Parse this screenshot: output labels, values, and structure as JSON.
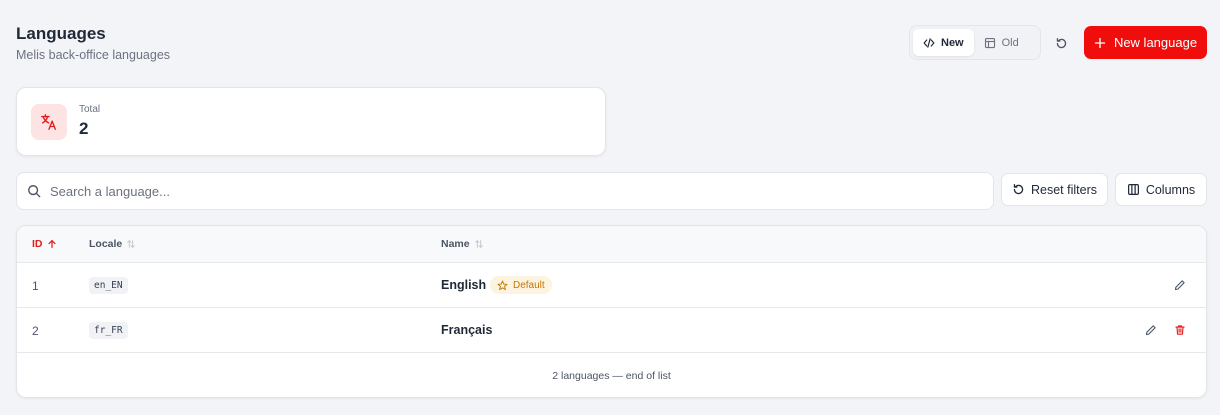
{
  "header": {
    "title": "Languages",
    "subtitle": "Melis back-office languages"
  },
  "view_toggle": {
    "options": [
      {
        "label": "New",
        "icon": "code-icon",
        "active": true
      },
      {
        "label": "Old",
        "icon": "layout-icon",
        "active": false
      }
    ]
  },
  "actions": {
    "refresh_icon": "refresh-icon",
    "new_language_label": "New language"
  },
  "stats": {
    "total_label": "Total",
    "total_value": "2",
    "icon": "translate-icon"
  },
  "search": {
    "placeholder": "Search a language...",
    "value": ""
  },
  "toolbar": {
    "reset_filters_label": "Reset filters",
    "columns_label": "Columns"
  },
  "table": {
    "columns": [
      {
        "label": "ID",
        "sort": "asc"
      },
      {
        "label": "Locale",
        "sort": "none"
      },
      {
        "label": "Name",
        "sort": "none"
      }
    ],
    "rows": [
      {
        "id": "1",
        "locale": "en_EN",
        "name": "English",
        "badge": "Default",
        "actions": [
          "edit"
        ]
      },
      {
        "id": "2",
        "locale": "fr_FR",
        "name": "Français",
        "badge": "",
        "actions": [
          "edit",
          "delete"
        ]
      }
    ],
    "footer": "2 languages — end of list"
  },
  "colors": {
    "accent": "#f20d0d",
    "sorted_header": "#e11d1d",
    "badge_bg": "#fdf3e1",
    "badge_text": "#c2790a",
    "background": "#f3f4f7"
  }
}
